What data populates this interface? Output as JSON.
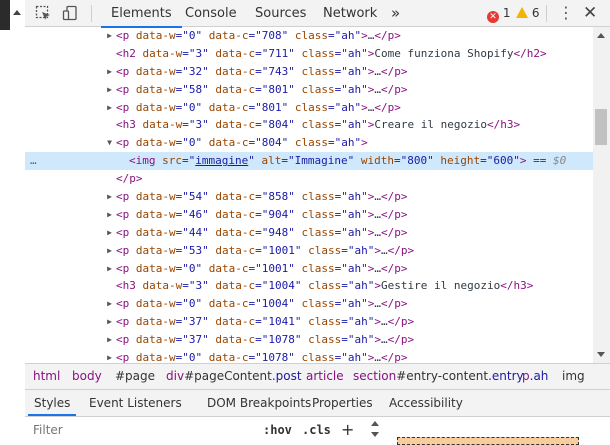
{
  "toolbar": {
    "tabs": [
      {
        "label": "Elements"
      },
      {
        "label": "Console"
      },
      {
        "label": "Sources"
      },
      {
        "label": "Network"
      },
      {
        "label": "»"
      }
    ],
    "errors": "1",
    "warnings": "6",
    "inspect_icon": "cursor-select-icon",
    "device_icon": "device-toggle-icon",
    "kebab": "⋮",
    "close": "✕"
  },
  "dom": {
    "rows": [
      {
        "caret": "▶",
        "indent": 1,
        "html": "<p data-w=\"0\" data-c=\"708\" class=\"ah\">…</p>"
      },
      {
        "caret": "",
        "indent": 1,
        "html": "<h2 data-w=\"3\" data-c=\"711\" class=\"ah\">Come funziona Shopify</h2>"
      },
      {
        "caret": "▶",
        "indent": 1,
        "html": "<p data-w=\"32\" data-c=\"743\" class=\"ah\">…</p>"
      },
      {
        "caret": "▶",
        "indent": 1,
        "html": "<p data-w=\"58\" data-c=\"801\" class=\"ah\">…</p>"
      },
      {
        "caret": "▶",
        "indent": 1,
        "html": "<p data-w=\"0\" data-c=\"801\" class=\"ah\">…</p>"
      },
      {
        "caret": "",
        "indent": 1,
        "html": "<h3 data-w=\"3\" data-c=\"804\" class=\"ah\">Creare il negozio</h3>"
      },
      {
        "caret": "▼",
        "indent": 1,
        "html": "<p data-w=\"0\" data-c=\"804\" class=\"ah\">"
      },
      {
        "caret": "",
        "indent": 2,
        "selected": true,
        "html": "<img src=\"immagine\" alt=\"Immagine\" width=\"800\" height=\"600\"> == $0"
      },
      {
        "caret": "",
        "indent": 1,
        "html": "</p>"
      },
      {
        "caret": "▶",
        "indent": 1,
        "html": "<p data-w=\"54\" data-c=\"858\" class=\"ah\">…</p>"
      },
      {
        "caret": "▶",
        "indent": 1,
        "html": "<p data-w=\"46\" data-c=\"904\" class=\"ah\">…</p>"
      },
      {
        "caret": "▶",
        "indent": 1,
        "html": "<p data-w=\"44\" data-c=\"948\" class=\"ah\">…</p>"
      },
      {
        "caret": "▶",
        "indent": 1,
        "html": "<p data-w=\"53\" data-c=\"1001\" class=\"ah\">…</p>"
      },
      {
        "caret": "▶",
        "indent": 1,
        "html": "<p data-w=\"0\" data-c=\"1001\" class=\"ah\">…</p>"
      },
      {
        "caret": "",
        "indent": 1,
        "html": "<h3 data-w=\"3\" data-c=\"1004\" class=\"ah\">Gestire il negozio</h3>"
      },
      {
        "caret": "▶",
        "indent": 1,
        "html": "<p data-w=\"0\" data-c=\"1004\" class=\"ah\">…</p>"
      },
      {
        "caret": "▶",
        "indent": 1,
        "html": "<p data-w=\"37\" data-c=\"1041\" class=\"ah\">…</p>"
      },
      {
        "caret": "▶",
        "indent": 1,
        "html": "<p data-w=\"37\" data-c=\"1078\" class=\"ah\">…</p>"
      },
      {
        "caret": "▶",
        "indent": 1,
        "html": "<p data-w=\"0\" data-c=\"1078\" class=\"ah\">…</p>"
      }
    ],
    "selected_dots": "…"
  },
  "breadcrumb": [
    {
      "tag": "html",
      "rest": ""
    },
    {
      "tag": "body",
      "rest": ""
    },
    {
      "tag": "",
      "rest": "#page"
    },
    {
      "tag": "div",
      "rest": "#pageContent.post"
    },
    {
      "tag": "article",
      "rest": ""
    },
    {
      "tag": "section",
      "rest": "#entry-content.entry"
    },
    {
      "tag": "p",
      "rest": ".ah"
    },
    {
      "tag": "img",
      "rest": ""
    }
  ],
  "styles_tabs": [
    {
      "label": "Styles"
    },
    {
      "label": "Event Listeners"
    },
    {
      "label": "DOM Breakpoints"
    },
    {
      "label": "Properties"
    },
    {
      "label": "Accessibility"
    }
  ],
  "filter": {
    "placeholder": "Filter",
    "hov": ":hov",
    "cls": ".cls",
    "plus": "+"
  },
  "colors": {
    "accent": "#1a73e8",
    "tag": "#881280",
    "attr_name": "#994500",
    "attr_value": "#1a1aa6",
    "selection": "#cfe8fc",
    "error": "#e53935",
    "warning": "#f4b400"
  }
}
